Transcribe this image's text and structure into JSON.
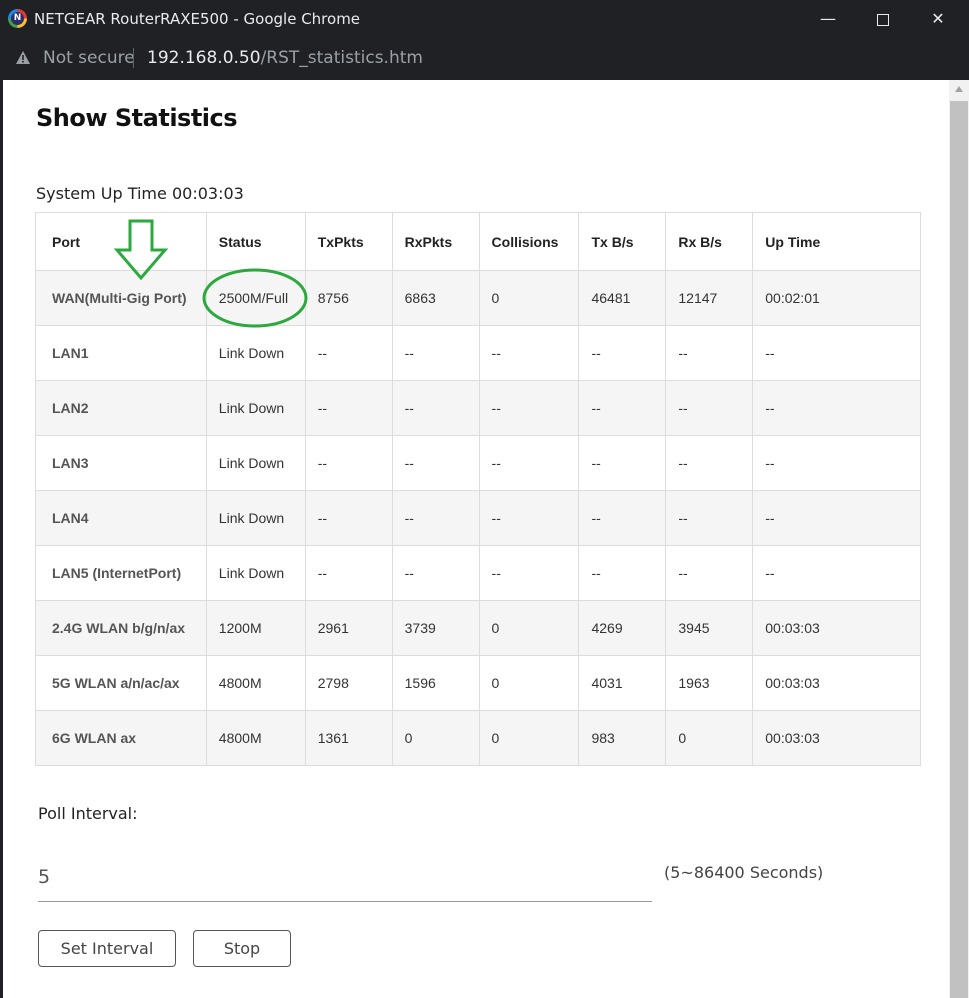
{
  "window": {
    "title": "NETGEAR RouterRAXE500 - Google Chrome",
    "app_icon_letter": "N",
    "minimize_glyph": "—",
    "close_glyph": "✕"
  },
  "address_bar": {
    "security_label": "Not secure",
    "url_host": "192.168.0.50",
    "url_path": "/RST_statistics.htm"
  },
  "page": {
    "title": "Show Statistics",
    "uptime_label": "System Up Time",
    "uptime_value": "00:03:03"
  },
  "table": {
    "headers": [
      "Port",
      "Status",
      "TxPkts",
      "RxPkts",
      "Collisions",
      "Tx B/s",
      "Rx B/s",
      "Up Time"
    ],
    "rows": [
      [
        "WAN(Multi-Gig Port)",
        "2500M/Full",
        "8756",
        "6863",
        "0",
        "46481",
        "12147",
        "00:02:01"
      ],
      [
        "LAN1",
        "Link Down",
        "--",
        "--",
        "--",
        "--",
        "--",
        "--"
      ],
      [
        "LAN2",
        "Link Down",
        "--",
        "--",
        "--",
        "--",
        "--",
        "--"
      ],
      [
        "LAN3",
        "Link Down",
        "--",
        "--",
        "--",
        "--",
        "--",
        "--"
      ],
      [
        "LAN4",
        "Link Down",
        "--",
        "--",
        "--",
        "--",
        "--",
        "--"
      ],
      [
        "LAN5 (InternetPort)",
        "Link Down",
        "--",
        "--",
        "--",
        "--",
        "--",
        "--"
      ],
      [
        "2.4G WLAN b/g/n/ax",
        "1200M",
        "2961",
        "3739",
        "0",
        "4269",
        "3945",
        "00:03:03"
      ],
      [
        "5G WLAN a/n/ac/ax",
        "4800M",
        "2798",
        "1596",
        "0",
        "4031",
        "1963",
        "00:03:03"
      ],
      [
        "6G WLAN ax",
        "4800M",
        "1361",
        "0",
        "0",
        "983",
        "0",
        "00:03:03"
      ]
    ]
  },
  "poll": {
    "label": "Poll Interval:",
    "value": "5",
    "range_hint": "(5~86400 Seconds)"
  },
  "buttons": {
    "set_interval": "Set Interval",
    "stop": "Stop"
  },
  "annotations": {
    "color": "#2ca83f",
    "arrow_icon": "down-arrow-annotation",
    "circle_icon": "circle-annotation"
  }
}
